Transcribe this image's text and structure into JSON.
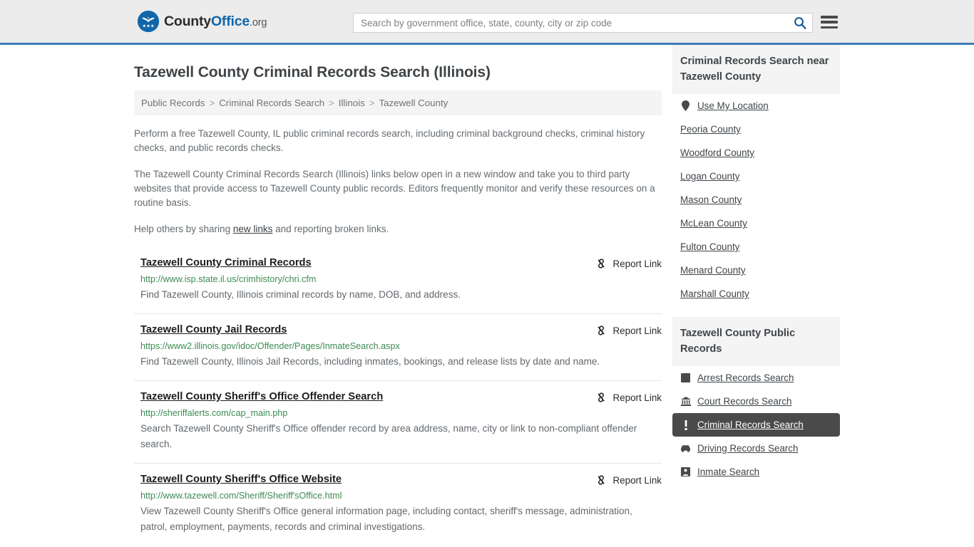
{
  "header": {
    "logo_text_1": "County",
    "logo_text_2": "Office",
    "logo_text_3": ".org",
    "logo_icon": "eagle-seal-icon",
    "search_placeholder": "Search by government office, state, county, city or zip code",
    "search_value": "",
    "search_icon": "search-icon",
    "menu_icon": "hamburger-menu-icon"
  },
  "main": {
    "title": "Tazewell County Criminal Records Search (Illinois)",
    "breadcrumb": [
      {
        "label": "Public Records"
      },
      {
        "label": "Criminal Records Search"
      },
      {
        "label": "Illinois"
      },
      {
        "label": "Tazewell County"
      }
    ],
    "breadcrumb_separator": ">",
    "intro": {
      "p1": "Perform a free Tazewell County, IL public criminal records search, including criminal background checks, criminal history checks, and public records checks.",
      "p2": "The Tazewell County Criminal Records Search (Illinois) links below open in a new window and take you to third party websites that provide access to Tazewell County public records. Editors frequently monitor and verify these resources on a routine basis.",
      "p3_before": "Help others by sharing ",
      "p3_link": "new links",
      "p3_after": " and reporting broken links."
    },
    "report_link_label": "Report Link",
    "report_link_icon": "broken-link-icon",
    "links": [
      {
        "title": "Tazewell County Criminal Records",
        "url": "http://www.isp.state.il.us/crimhistory/chri.cfm",
        "desc": "Find Tazewell County, Illinois criminal records by name, DOB, and address."
      },
      {
        "title": "Tazewell County Jail Records",
        "url": "https://www2.illinois.gov/idoc/Offender/Pages/InmateSearch.aspx",
        "desc": "Find Tazewell County, Illinois Jail Records, including inmates, bookings, and release lists by date and name."
      },
      {
        "title": "Tazewell County Sheriff's Office Offender Search",
        "url": "http://sheriffalerts.com/cap_main.php",
        "desc": "Search Tazewell County Sheriff's Office offender record by area address, name, city or link to non-compliant offender search."
      },
      {
        "title": "Tazewell County Sheriff's Office Website",
        "url": "http://www.tazewell.com/Sheriff/Sheriff'sOffice.html",
        "desc": "View Tazewell County Sheriff's Office general information page, including contact, sheriff's message, administration, patrol, employment, payments, records and criminal investigations."
      }
    ]
  },
  "sidebar": {
    "nearby_heading": "Criminal Records Search near Tazewell County",
    "use_my_location": {
      "label": "Use My Location",
      "icon": "map-pin-icon"
    },
    "nearby_counties": [
      "Peoria County",
      "Woodford County",
      "Logan County",
      "Mason County",
      "McLean County",
      "Fulton County",
      "Menard County",
      "Marshall County"
    ],
    "public_records_heading": "Tazewell County Public Records",
    "public_records": [
      {
        "label": "Arrest Records Search",
        "icon": "fingerprint-square-icon",
        "active": false
      },
      {
        "label": "Court Records Search",
        "icon": "courthouse-icon",
        "active": false
      },
      {
        "label": "Criminal Records Search",
        "icon": "exclamation-icon",
        "active": true
      },
      {
        "label": "Driving Records Search",
        "icon": "car-icon",
        "active": false
      },
      {
        "label": "Inmate Search",
        "icon": "inmate-icon",
        "active": false
      }
    ]
  },
  "colors": {
    "header_bg": "#ececec",
    "header_border": "#3d7ab5",
    "brand_blue": "#1166aa",
    "url_green": "#3d8b52",
    "highlight_bg": "#4a4a4a",
    "panel_bg": "#f4f4f4"
  }
}
